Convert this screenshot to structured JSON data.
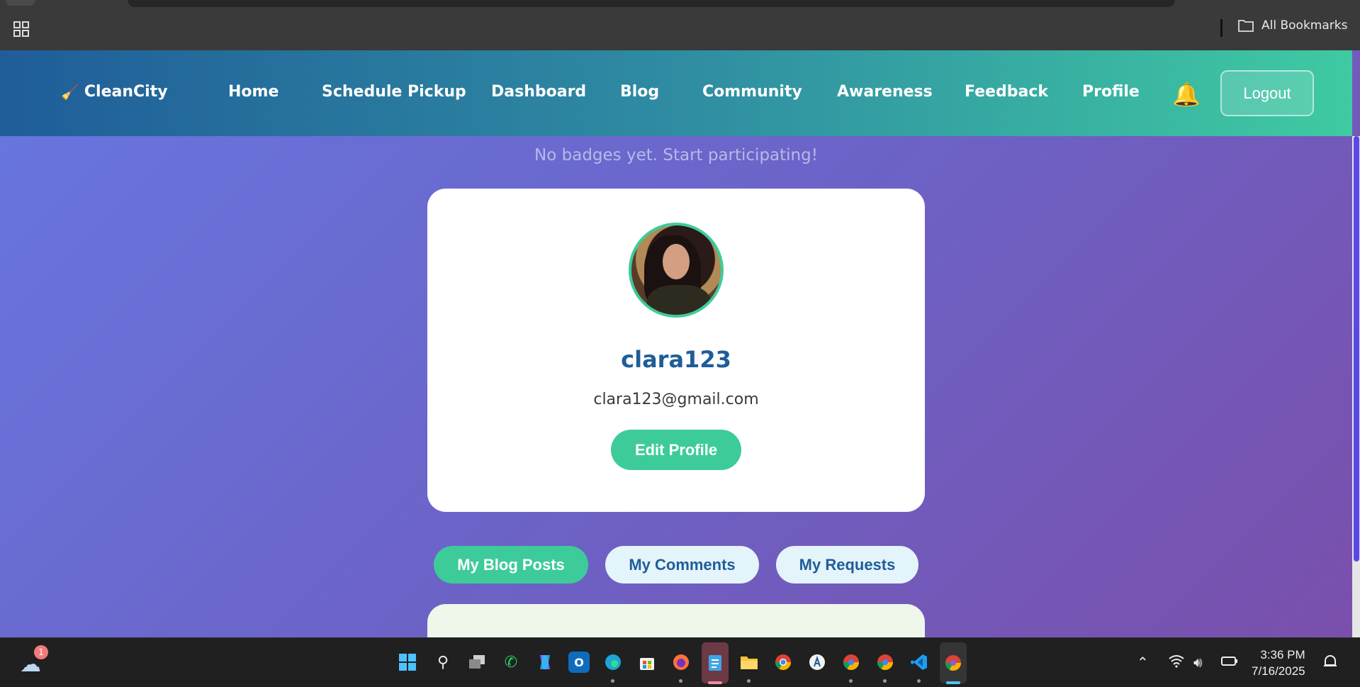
{
  "browser": {
    "bookmarks_label": "All Bookmarks"
  },
  "navbar": {
    "brand": "CleanCity",
    "links": [
      "Home",
      "Schedule Pickup",
      "Dashboard",
      "Blog",
      "Community",
      "Awareness",
      "Feedback",
      "Profile"
    ],
    "logout_label": "Logout"
  },
  "profile": {
    "badges_message": "No badges yet. Start participating!",
    "username": "clara123",
    "email": "clara123@gmail.com",
    "edit_label": "Edit Profile",
    "tabs": [
      {
        "label": "My Blog Posts",
        "active": true
      },
      {
        "label": "My Comments",
        "active": false
      },
      {
        "label": "My Requests",
        "active": false
      }
    ]
  },
  "taskbar": {
    "weather_badge": "1",
    "time": "3:36 PM",
    "date": "7/16/2025",
    "apps": [
      "windows-start",
      "search",
      "task-view",
      "whatsapp",
      "copilot",
      "outlook",
      "edge",
      "microsoft-store",
      "firefox",
      "notepad",
      "file-explorer",
      "chrome",
      "app-store",
      "chrome-profile-2",
      "chrome-profile-3",
      "vscode",
      "chrome-profile-4"
    ]
  },
  "colors": {
    "brand_dark": "#1f5d99",
    "accent": "#3ecb9a",
    "page_gradient_start": "#6777e0",
    "page_gradient_end": "#7a4fab"
  }
}
